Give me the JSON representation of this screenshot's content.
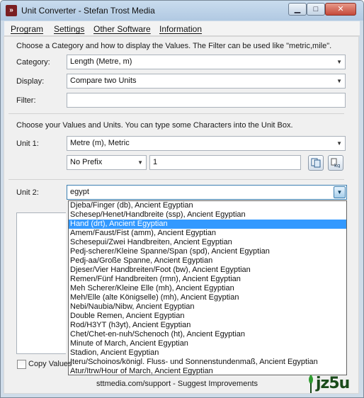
{
  "window": {
    "title": "Unit Converter - Stefan Trost Media"
  },
  "menu": [
    "Program",
    "Settings",
    "Other Software",
    "Information"
  ],
  "hints": {
    "top": "Choose a Category and how to display the Values. The Filter can be used like \"metric,mile\".",
    "values": "Choose your Values and Units. You can type some Characters into the Unit Box."
  },
  "labels": {
    "category": "Category:",
    "display": "Display:",
    "filter": "Filter:",
    "unit1": "Unit 1:",
    "unit2": "Unit 2:"
  },
  "fields": {
    "category": "Length (Metre, m)",
    "display": "Compare two Units",
    "filter": "",
    "unit1": "Metre (m), Metric",
    "prefix": "No Prefix",
    "value": "1",
    "unit2": "egypt"
  },
  "unit2_options": [
    "Djeba/Finger (db), Ancient Egyptian",
    "Schesep/Henet/Handbreite (ssp), Ancient Egyptian",
    "Hand (drt), Ancient Egyptian",
    "Amem/Faust/Fist (amm), Ancient Egyptian",
    "Schesepui/Zwei Handbreiten, Ancient Egyptian",
    "Pedj-scherer/Kleine Spanne/Span (spd), Ancient Egyptian",
    "Pedj-aa/Große Spanne, Ancient Egyptian",
    "Djeser/Vier Handbreiten/Foot (bw), Ancient Egyptian",
    "Remen/Fünf Handbreiten (rmn), Ancient Egyptian",
    "Meh Scherer/Kleine Elle (mh), Ancient Egyptian",
    "Meh/Elle (alte Königselle) (mh), Ancient Egyptian",
    "Nebi/Naubia/Nibw, Ancient Egyptian",
    "Double Remen, Ancient Egyptian",
    "Rod/H3YT (h3yt), Ancient Egyptian",
    "Chet/Chet-en-nuh/Schenoch (ht), Ancient Egyptian",
    "Minute of March, Ancient Egyptian",
    "Stadion, Ancient Egyptian",
    "Iteru/Schoinos/königl. Fluss- und Sonnenstundenmaß, Ancient Egyptian",
    "Atur/Itrw/Hour of March, Ancient Egyptian"
  ],
  "selected_index": 2,
  "copy_checkbox": {
    "label": "Copy Values",
    "checked": false
  },
  "footer": "sttmedia.com/support - Suggest Improvements",
  "watermark": "jz5u",
  "colors": {
    "accent": "#3399ff",
    "titlebar": "#b9cfe6"
  }
}
